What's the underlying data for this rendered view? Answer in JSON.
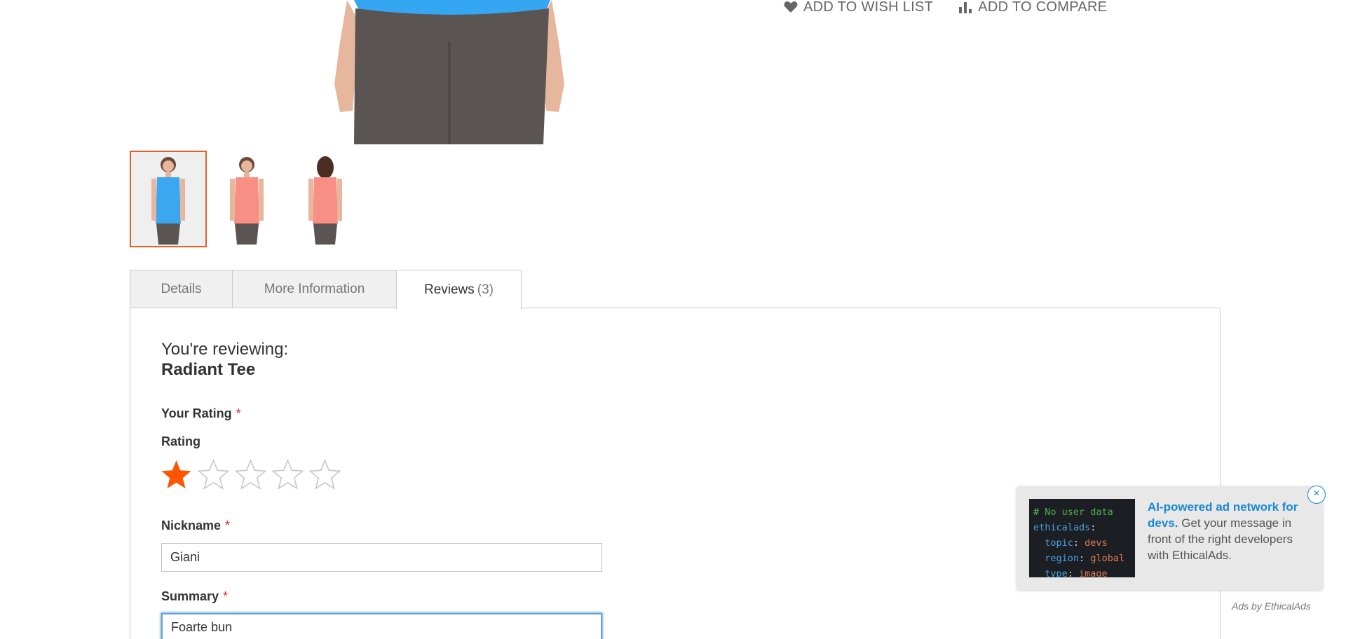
{
  "product_actions": {
    "wishlist_label": "ADD TO WISH LIST",
    "compare_label": "ADD TO COMPARE"
  },
  "gallery": {
    "thumbnails": [
      {
        "alt": "blue-tee-front",
        "color": "#3aa7f0",
        "active": true
      },
      {
        "alt": "pink-tee-front",
        "color": "#f78f84",
        "active": false
      },
      {
        "alt": "pink-tee-back",
        "color": "#f78f84",
        "active": false
      }
    ]
  },
  "tabs": {
    "details": "Details",
    "more_info": "More Information",
    "reviews": "Reviews",
    "reviews_count": "(3)"
  },
  "review_form": {
    "reviewing_label": "You're reviewing:",
    "product_name": "Radiant Tee",
    "your_rating_label": "Your Rating",
    "required_mark": "*",
    "rating_label": "Rating",
    "rating_value": 1,
    "rating_max": 5,
    "nickname_label": "Nickname",
    "nickname_value": "Giani",
    "summary_label": "Summary",
    "summary_value": "Foarte bun"
  },
  "ad": {
    "code_lines": [
      {
        "key": "# No user data",
        "val": ""
      },
      {
        "key": "ethicalads",
        "val": ""
      },
      {
        "key": "topic",
        "val": "devs"
      },
      {
        "key": "region",
        "val": "global"
      },
      {
        "key": "type",
        "val": "image"
      }
    ],
    "headline": "AI-powered ad network for devs.",
    "body": "Get your message in front of the right developers with EthicalAds.",
    "close_label": "×",
    "attribution": "Ads by EthicalAds"
  },
  "colors": {
    "accent": "#e35f26",
    "star_filled": "#ff5501",
    "star_empty": "#c7c7c7",
    "required": "#e02b27",
    "ad_link": "#1a8ad3"
  }
}
